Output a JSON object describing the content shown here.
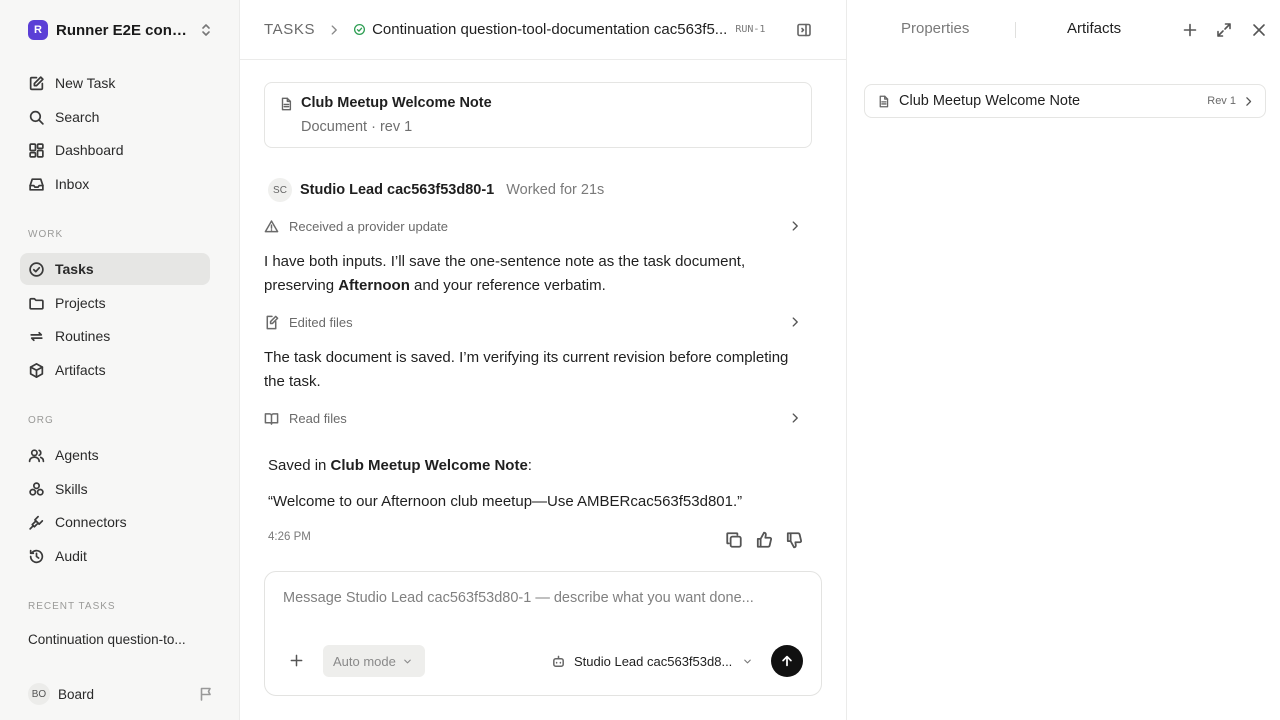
{
  "workspace": {
    "logo_letter": "R",
    "name": "Runner E2E conti..."
  },
  "sidebar": {
    "primary": [
      {
        "label": "New Task"
      },
      {
        "label": "Search"
      },
      {
        "label": "Dashboard"
      },
      {
        "label": "Inbox"
      }
    ],
    "work_label": "WORK",
    "work": [
      {
        "label": "Tasks"
      },
      {
        "label": "Projects"
      },
      {
        "label": "Routines"
      },
      {
        "label": "Artifacts"
      }
    ],
    "org_label": "ORG",
    "org": [
      {
        "label": "Agents"
      },
      {
        "label": "Skills"
      },
      {
        "label": "Connectors"
      },
      {
        "label": "Audit"
      }
    ],
    "recent_label": "RECENT TASKS",
    "recent": [
      {
        "label": "Continuation question-to..."
      }
    ],
    "user": {
      "initials": "BO",
      "name": "Board"
    }
  },
  "header": {
    "root": "TASKS",
    "title": "Continuation question-tool-documentation cac563f5...",
    "run_id": "RUN-1"
  },
  "document_card": {
    "title": "Club Meetup Welcome Note",
    "subtitle": "Document · rev 1"
  },
  "agent": {
    "initials": "SC",
    "name": "Studio Lead cac563f53d80-1",
    "worked": "Worked for 21s"
  },
  "events": [
    {
      "label": "Received a provider update",
      "icon": "warning-icon"
    },
    {
      "label": "Edited files",
      "icon": "edit-file-icon"
    },
    {
      "label": "Read files",
      "icon": "book-icon"
    }
  ],
  "messages": {
    "m1_a": "I have both inputs. I’ll save the one-sentence note as the task document, preserving ",
    "m1_bold": "Afternoon",
    "m1_b": " and your reference verbatim.",
    "m2": "The task document is saved. I’m verifying its current revision before completing the task.",
    "saved_prefix": "Saved in ",
    "saved_bold": "Club Meetup Welcome Note",
    "saved_suffix": ":",
    "quote": "“Welcome to our Afternoon club meetup—Use AMBERcac563f53d801.”",
    "timestamp": "4:26 PM"
  },
  "composer": {
    "placeholder": "Message Studio Lead cac563f53d80-1 — describe what you want done...",
    "mode": "Auto mode",
    "agent_selected": "Studio Lead cac563f53d8..."
  },
  "right_panel": {
    "tabs": {
      "properties": "Properties",
      "artifacts": "Artifacts"
    },
    "artifacts": [
      {
        "name": "Club Meetup Welcome Note",
        "rev": "Rev 1"
      }
    ]
  },
  "colors": {
    "accent_logo": "#5b3fd6",
    "status_ok": "#2e9e53",
    "send_button": "#111111",
    "sidebar_bg": "#f7f7f6",
    "active_item_bg": "#e6e6e4"
  }
}
